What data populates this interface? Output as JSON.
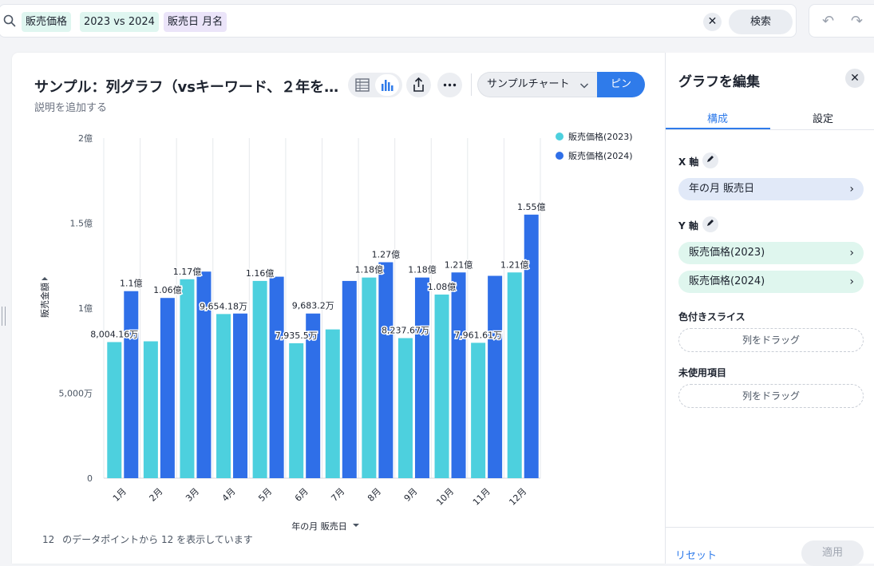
{
  "search": {
    "tokens": [
      {
        "label": "販売価格",
        "kind": "teal"
      },
      {
        "label": "2023 vs 2024",
        "kind": "teal"
      },
      {
        "label": "販売日 月名",
        "kind": "purple"
      }
    ],
    "clear_glyph": "✕",
    "search_label": "検索"
  },
  "chart": {
    "title": "サンプル：列グラフ（vsキーワード、２年を…",
    "description": "説明を追加する",
    "sample_dropdown": "サンプルチャート",
    "pin_label": "ピン",
    "footer_count_a": "12",
    "footer_count_b": "12",
    "footer_text_mid": "のデータポイントから",
    "footer_text_end": "を表示しています"
  },
  "chart_data": {
    "type": "bar",
    "categories": [
      "1月",
      "2月",
      "3月",
      "4月",
      "5月",
      "6月",
      "7月",
      "8月",
      "9月",
      "10月",
      "11月",
      "12月"
    ],
    "series": [
      {
        "name": "販売価格(2023)",
        "color": "#4dd0de",
        "values": [
          80041600,
          80500000,
          117000000,
          96541800,
          116000000,
          79355000,
          87500000,
          118000000,
          82376700,
          108000000,
          79616100,
          121000000
        ],
        "labels": [
          "8,004.16万",
          "",
          "1.17億",
          "9,654.18万",
          "1.16億",
          "7,935.5万",
          "",
          "1.18億",
          "8,237.67万",
          "1.08億",
          "7,961.61万",
          "1.21億"
        ]
      },
      {
        "name": "販売価格(2024)",
        "color": "#2f6fe8",
        "values": [
          110000000,
          106000000,
          121500000,
          96832000,
          118500000,
          96832000,
          116000000,
          127000000,
          118000000,
          121000000,
          119000000,
          155000000
        ],
        "labels": [
          "1.1億",
          "1.06億",
          "",
          "",
          "",
          "9,683.2万",
          "",
          "1.27億",
          "1.18億",
          "1.21億",
          "",
          "1.55億"
        ]
      }
    ],
    "xlabel": "年の月 販売日",
    "ylabel": "販売金額",
    "ylim": [
      0,
      200000000
    ],
    "yticks": [
      {
        "value": 0,
        "label": "0"
      },
      {
        "value": 50000000,
        "label": "5,000万"
      },
      {
        "value": 100000000,
        "label": "1億"
      },
      {
        "value": 150000000,
        "label": "1.5億"
      },
      {
        "value": 200000000,
        "label": "2億"
      }
    ],
    "grid": "vertical",
    "legend_position": "top-right"
  },
  "panel": {
    "title": "グラフを編集",
    "close_glyph": "✕",
    "tabs": [
      {
        "label": "構成",
        "active": true
      },
      {
        "label": "設定",
        "active": false
      }
    ],
    "x_axis_label": "X 軸",
    "x_axis_field": "年の月 販売日",
    "y_axis_label": "Y 軸",
    "y_axis_fields": [
      "販売価格(2023)",
      "販売価格(2024)"
    ],
    "color_slice_label": "色付きスライス",
    "color_slice_drop": "列をドラッグ",
    "unused_label": "未使用項目",
    "unused_drop": "列をドラッグ",
    "reset_label": "リセット",
    "apply_label": "適用"
  },
  "toolbar": {
    "undo_glyph": "↶",
    "redo_glyph": "↷"
  }
}
